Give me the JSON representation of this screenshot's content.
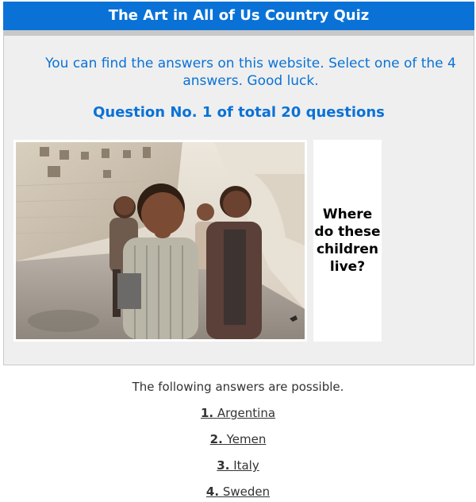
{
  "header": {
    "title": "The Art in All of Us Country Quiz"
  },
  "quiz": {
    "intro": "You can find the answers on this website. Select one of the 4 answers. Good luck.",
    "question_number": "Question No. 1 of total 20 questions",
    "question_text": "Where do these children live?",
    "image_semantic": "photo-children-street"
  },
  "answers": {
    "intro": "The following answers are possible.",
    "items": [
      {
        "num": "1.",
        "label": "Argentina"
      },
      {
        "num": "2.",
        "label": "Yemen"
      },
      {
        "num": "3.",
        "label": "Italy"
      },
      {
        "num": "4.",
        "label": "Sweden"
      }
    ]
  },
  "colors": {
    "accent": "#0a72d6",
    "panel_bg": "#efefef",
    "text": "#333333"
  }
}
